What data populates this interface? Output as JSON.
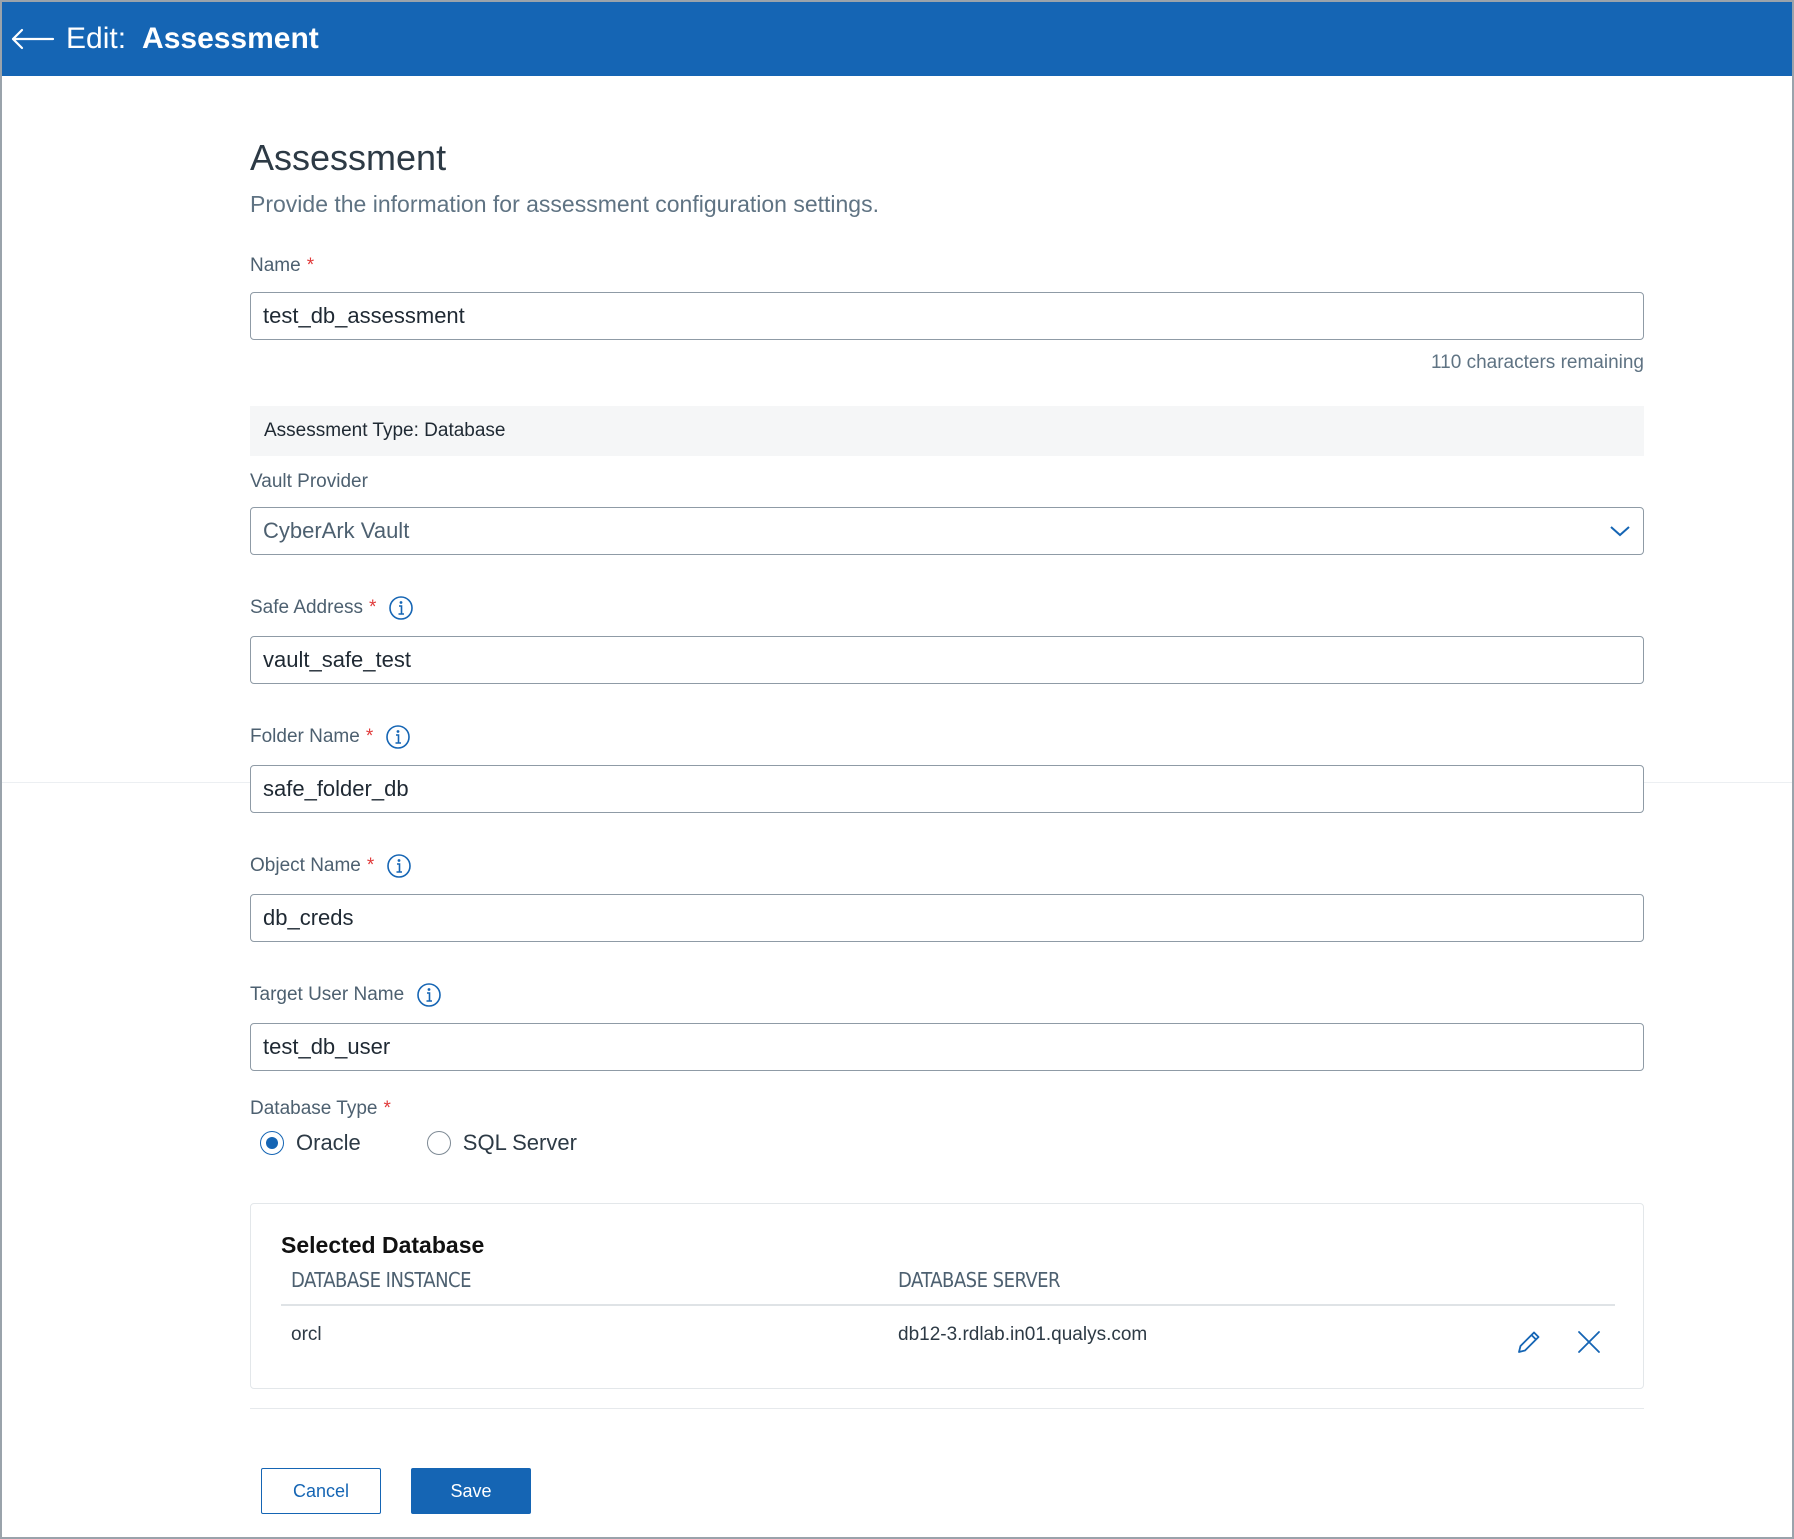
{
  "header": {
    "back_icon": "arrow-left-icon",
    "prefix": "Edit:",
    "title": "Assessment"
  },
  "page": {
    "title": "Assessment",
    "subtitle": "Provide the information for assessment configuration settings."
  },
  "fields": {
    "name": {
      "label": "Name",
      "value": "test_db_assessment",
      "remaining": "110 characters remaining"
    },
    "assessment_type": "Assessment Type: Database",
    "vault_provider": {
      "label": "Vault Provider",
      "value": "CyberArk Vault"
    },
    "safe_address": {
      "label": "Safe Address",
      "value": "vault_safe_test"
    },
    "folder_name": {
      "label": "Folder Name",
      "value": "safe_folder_db"
    },
    "object_name": {
      "label": "Object Name",
      "value": "db_creds"
    },
    "target_user": {
      "label": "Target User Name",
      "value": "test_db_user"
    },
    "database_type": {
      "label": "Database Type",
      "options": [
        "Oracle",
        "SQL Server"
      ],
      "selected": "Oracle"
    }
  },
  "selected_database": {
    "title": "Selected Database",
    "columns": [
      "DATABASE INSTANCE",
      "DATABASE SERVER"
    ],
    "rows": [
      {
        "instance": "orcl",
        "server": "db12-3.rdlab.in01.qualys.com"
      }
    ]
  },
  "actions": {
    "cancel": "Cancel",
    "save": "Save"
  },
  "colors": {
    "brand": "#1565b4",
    "required": "#e03a3a"
  }
}
